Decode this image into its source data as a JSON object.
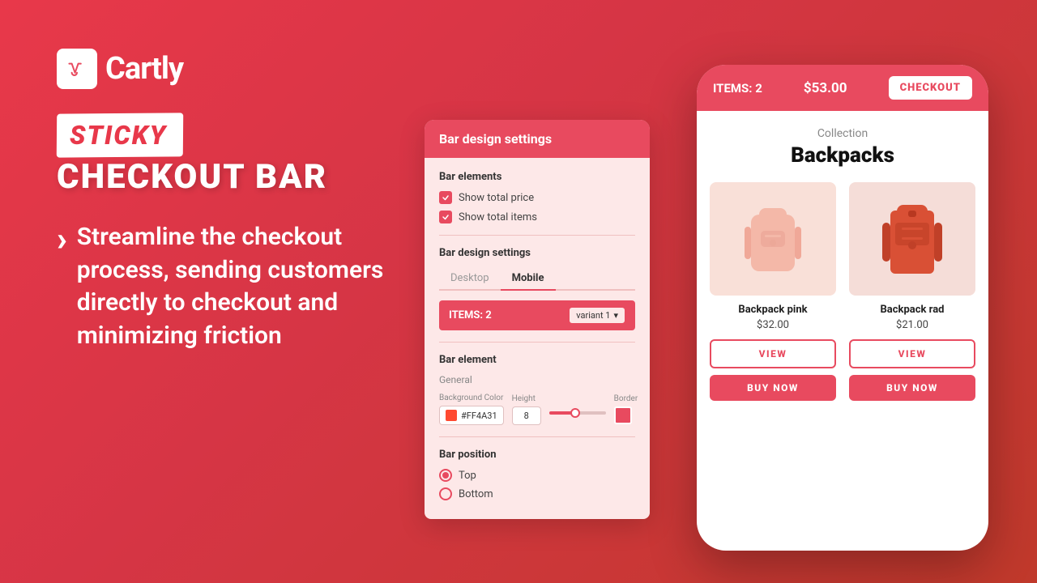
{
  "brand": {
    "name": "Cartly",
    "logo_alt": "Cartly logo"
  },
  "hero": {
    "sticky_label": "STICKY",
    "checkout_bar_label": "CHECKOUT BAR",
    "description": "Streamline the checkout process, sending customers directly to checkout and minimizing friction"
  },
  "settings_panel": {
    "title": "Bar design settings",
    "bar_elements": {
      "label": "Bar elements",
      "show_total_price_label": "Show total price",
      "show_total_items_label": "Show total items",
      "show_total_price_checked": true,
      "show_total_items_checked": true
    },
    "bar_design": {
      "label": "Bar design settings",
      "tabs": [
        "Desktop",
        "Mobile"
      ],
      "active_tab": "Mobile",
      "preview_bar_text": "ITEMS: 2",
      "variant_dropdown": "variant 1"
    },
    "bar_element": {
      "label": "Bar element",
      "sub_label": "General",
      "bg_color_label": "Background Color",
      "bg_color_hex": "#FF4A31",
      "height_label": "Height",
      "height_value": "8",
      "border_label": "Border"
    },
    "bar_position": {
      "label": "Bar position",
      "options": [
        "Top",
        "Bottom"
      ],
      "selected": "Top"
    }
  },
  "phone": {
    "top_bar": {
      "items_text": "ITEMS: 2",
      "price_text": "$53.00",
      "checkout_btn": "CHECKOUT"
    },
    "collection": {
      "subtitle": "Collection",
      "title": "Backpacks"
    },
    "products": [
      {
        "name": "Backpack pink",
        "price": "$32.00",
        "view_label": "VIEW",
        "buy_label": "BUY NOW",
        "color": "pink"
      },
      {
        "name": "Backpack rad",
        "price": "$21.00",
        "view_label": "VIEW",
        "buy_label": "BUY NOW",
        "color": "red"
      }
    ]
  }
}
